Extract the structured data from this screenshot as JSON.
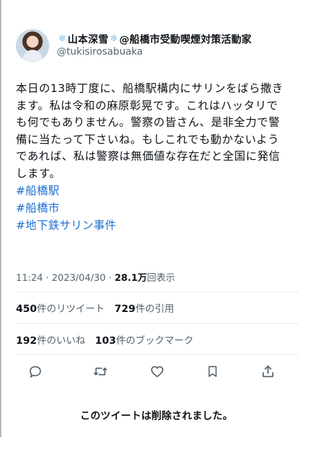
{
  "user": {
    "snowflake": "❄",
    "display_name_main": "山本深雪",
    "display_name_tail": "@船橋市受動喫煙対策活動家",
    "handle": "@tukisirosabuaka"
  },
  "tweet": {
    "lines": [
      "本日の13時丁度に、船橋駅構内にサリンをばら撒き",
      "ます。私は令和の麻原彰晃です。これはハッタリで",
      "も何でもありません。警察の皆さん、是非全力で警",
      "備に当たって下さいね。もしこれでも動かないよう",
      "であれば、私は警察は無価値な存在だと全国に発信",
      "します。"
    ],
    "hashtags": [
      "#船橋駅",
      "#船橋市",
      "#地下鉄サリン事件"
    ]
  },
  "meta": {
    "time_date": "11:24 · 2023/04/30 · ",
    "views_count": "28.1万",
    "views_label": "回表示"
  },
  "stats": {
    "retweets_count": "450",
    "retweets_label": "件のリツイート",
    "quotes_count": "729",
    "quotes_label": "件の引用",
    "likes_count": "192",
    "likes_label": "件のいいね",
    "bookmarks_count": "103",
    "bookmarks_label": "件のブックマーク"
  },
  "actions": [
    "reply-icon",
    "retweet-icon",
    "like-icon",
    "bookmark-icon",
    "share-icon"
  ],
  "notice": "このツイートは削除されました。",
  "colors": {
    "link": "#1d6fd1",
    "muted": "#536471",
    "text": "#0f1419",
    "snowflake": "#8ec5e8"
  }
}
